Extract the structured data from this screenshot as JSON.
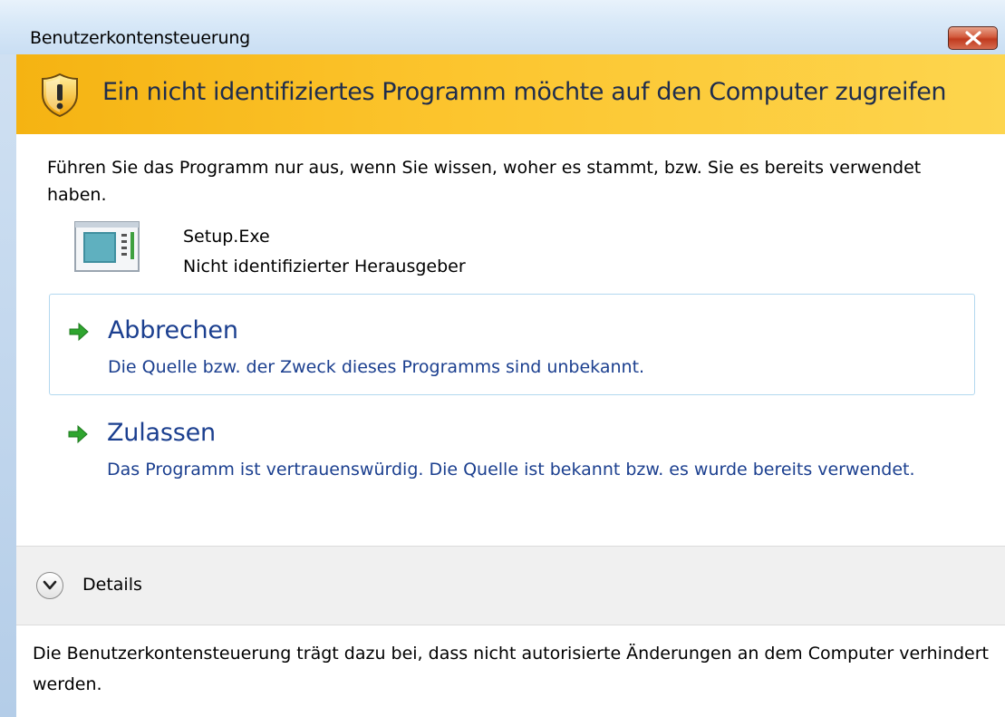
{
  "window": {
    "title": "Benutzerkontensteuerung",
    "banner_title": "Ein nicht identifiziertes Programm möchte auf den Computer zugreifen"
  },
  "intro_text": "Führen Sie das Programm nur aus, wenn Sie wissen, woher es stammt, bzw. Sie es bereits verwendet haben.",
  "program": {
    "name": "Setup.Exe",
    "publisher": "Nicht identifizierter Herausgeber"
  },
  "options": [
    {
      "title": "Abbrechen",
      "description": "Die Quelle bzw. der Zweck dieses Programms sind unbekannt."
    },
    {
      "title": "Zulassen",
      "description": "Das Programm ist vertrauenswürdig. Die Quelle ist bekannt bzw. es wurde bereits verwendet."
    }
  ],
  "details_label": "Details",
  "footer_text": "Die Benutzerkontensteuerung trägt dazu bei, dass nicht autorisierte Änderungen an dem Computer verhindert werden.",
  "icons": {
    "close": "close-icon",
    "shield": "shield-warning-icon",
    "program": "program-icon",
    "arrow": "green-arrow-icon",
    "chevron": "chevron-down-icon"
  },
  "colors": {
    "banner": "#fcc52e",
    "link_text": "#1b3f8f",
    "arrow": "#2fa52f",
    "close_button": "#c03a1e"
  }
}
